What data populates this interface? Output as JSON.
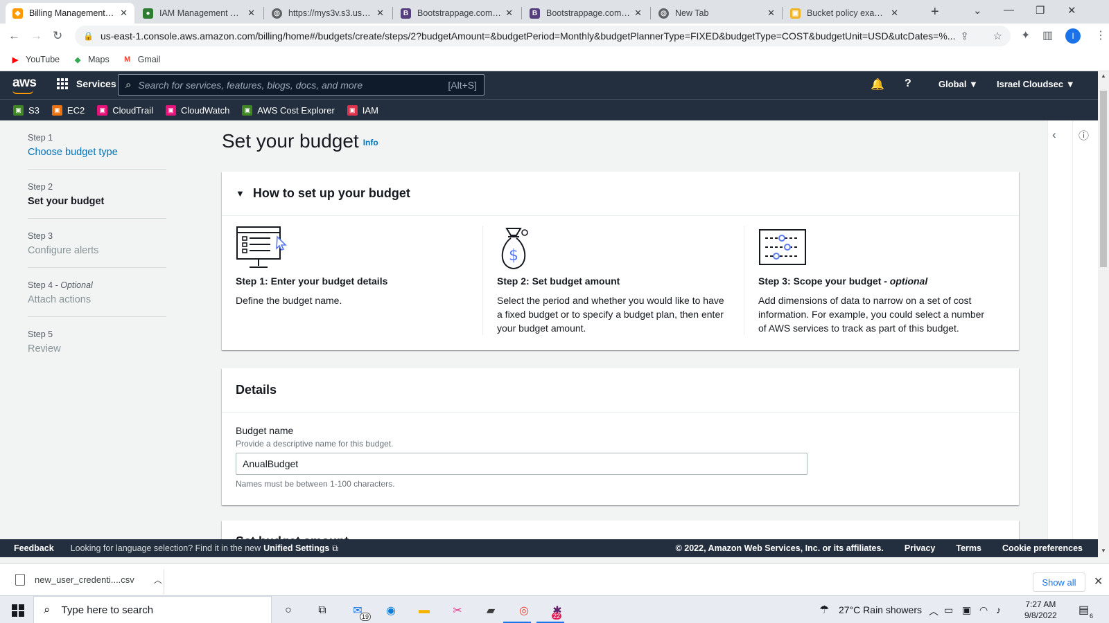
{
  "browser": {
    "tabs": [
      {
        "title": "Billing Management Co",
        "favicon_color": "#ff9900",
        "active": true
      },
      {
        "title": "IAM Management Cons",
        "favicon_color": "#2e7d32",
        "active": false
      },
      {
        "title": "https://mys3v.s3.us-eas",
        "favicon_color": "#5f6368",
        "active": false
      },
      {
        "title": "Bootstrappage.com fre",
        "favicon_color": "#563d7c",
        "active": false
      },
      {
        "title": "Bootstrappage.com fre",
        "favicon_color": "#563d7c",
        "active": false
      },
      {
        "title": "New Tab",
        "favicon_color": "#5f6368",
        "active": false
      },
      {
        "title": "Bucket policy examples",
        "favicon_color": "#f0b429",
        "active": false
      }
    ],
    "url": "us-east-1.console.aws.amazon.com/billing/home#/budgets/create/steps/2?budgetAmount=&budgetPeriod=Monthly&budgetPlannerType=FIXED&budgetType=COST&budgetUnit=USD&utcDates=%...",
    "profile_initial": "I",
    "bookmarks": [
      {
        "label": "YouTube",
        "icon": "youtube-icon"
      },
      {
        "label": "Maps",
        "icon": "maps-icon"
      },
      {
        "label": "Gmail",
        "icon": "gmail-icon"
      }
    ]
  },
  "aws": {
    "logo_text": "aws",
    "services_label": "Services",
    "search_placeholder": "Search for services, features, blogs, docs, and more",
    "search_shortcut": "[Alt+S]",
    "region": "Global ▼",
    "account": "Israel Cloudsec ▼",
    "favorites": [
      {
        "label": "S3",
        "color": "#3f8624",
        "icon": "s3-icon"
      },
      {
        "label": "EC2",
        "color": "#ec7211",
        "icon": "ec2-icon"
      },
      {
        "label": "CloudTrail",
        "color": "#e7157b",
        "icon": "cloudtrail-icon"
      },
      {
        "label": "CloudWatch",
        "color": "#e7157b",
        "icon": "cloudwatch-icon"
      },
      {
        "label": "AWS Cost Explorer",
        "color": "#3f8624",
        "icon": "cost-explorer-icon"
      },
      {
        "label": "IAM",
        "color": "#dd344c",
        "icon": "iam-icon"
      }
    ]
  },
  "wizard": {
    "steps": [
      {
        "label": "Step 1",
        "name": "Choose budget type",
        "state": "link"
      },
      {
        "label": "Step 2",
        "name": "Set your budget",
        "state": "cur"
      },
      {
        "label": "Step 3",
        "name": "Configure alerts",
        "state": "dis"
      },
      {
        "label": "Step 4 - ",
        "label_extra": "Optional",
        "name": "Attach actions",
        "state": "dis"
      },
      {
        "label": "Step 5",
        "name": "Review",
        "state": "dis"
      }
    ]
  },
  "page": {
    "title": "Set your budget",
    "info": "Info"
  },
  "howto": {
    "heading": "How to set up your budget",
    "cols": [
      {
        "title": "Step 1: Enter your budget details",
        "title_extra": "",
        "desc": "Define the budget name."
      },
      {
        "title": "Step 2: Set budget amount",
        "title_extra": "",
        "desc": "Select the period and whether you would like to have a fixed budget or to specify a budget plan, then enter your budget amount."
      },
      {
        "title": "Step 3: Scope your budget - ",
        "title_extra": "optional",
        "desc": "Add dimensions of data to narrow on a set of cost information. For example, you could select a number of AWS services to track as part of this budget."
      }
    ]
  },
  "details": {
    "heading": "Details",
    "budget_name_label": "Budget name",
    "budget_name_desc": "Provide a descriptive name for this budget.",
    "budget_name_value": "AnualBudget",
    "budget_name_hint": "Names must be between 1-100 characters."
  },
  "next_panel_heading": "Set budget amount",
  "footer": {
    "feedback": "Feedback",
    "lang_text": "Looking for language selection? Find it in the new",
    "unified": "Unified Settings",
    "copyright": "© 2022, Amazon Web Services, Inc. or its affiliates.",
    "privacy": "Privacy",
    "terms": "Terms",
    "cookies": "Cookie preferences"
  },
  "downloads": {
    "file": "new_user_credenti....csv",
    "show_all": "Show all"
  },
  "taskbar": {
    "search_placeholder": "Type here to search",
    "weather": "27°C  Rain showers",
    "time": "7:27 AM",
    "date": "9/8/2022",
    "mail_badge": "19",
    "slack_badge": "22",
    "notif_badge": "6"
  }
}
